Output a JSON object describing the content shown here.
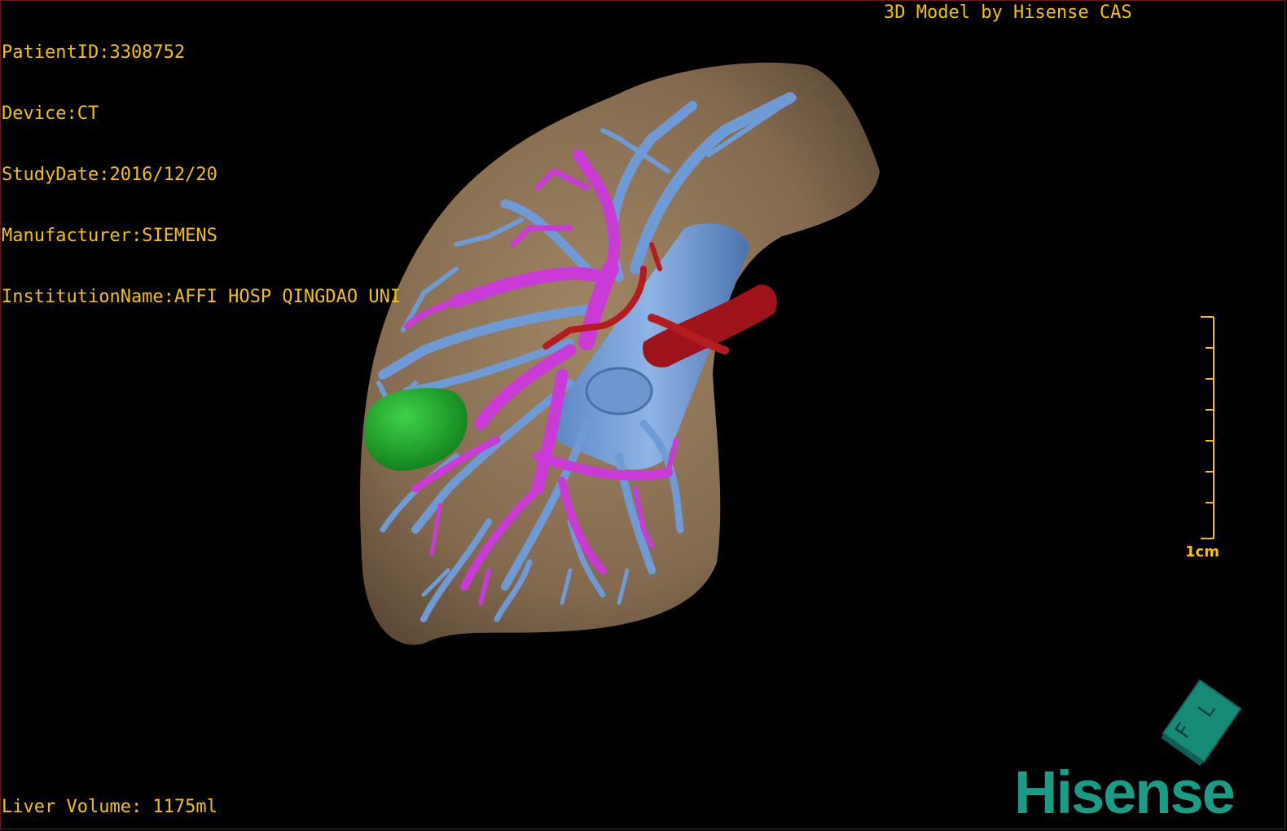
{
  "patient_info": {
    "patient_id": "PatientID:3308752",
    "device": "Device:CT",
    "study_date": "StudyDate:2016/12/20",
    "manufacturer": "Manufacturer:SIEMENS",
    "institution": "InstitutionName:AFFI HOSP QINGDAO UNI"
  },
  "viewer": {
    "title": "3D Model by Hisense CAS",
    "liver_volume": "Liver Volume: 1175ml",
    "scale_bar_label": "1cm"
  },
  "branding": {
    "logo_text": "Hisense",
    "cube_letters": "F L"
  },
  "colors": {
    "overlay_text": "#f2c200",
    "liver": "#8a7156",
    "hepatic_vein": "#6e9bd6",
    "portal_vein": "#c93ad6",
    "artery": "#a8161b",
    "tumor": "#1fae2a",
    "brand": "#1a9d86"
  }
}
